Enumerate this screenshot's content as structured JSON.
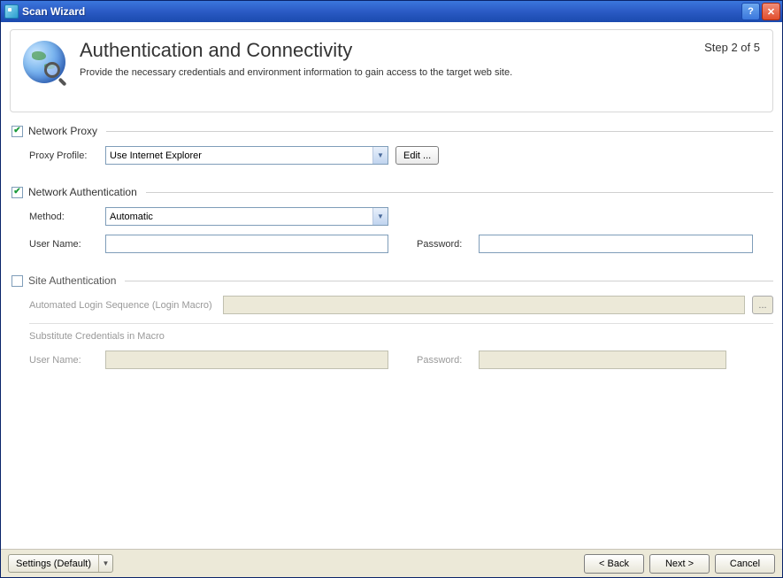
{
  "window": {
    "title": "Scan Wizard"
  },
  "header": {
    "title": "Authentication and Connectivity",
    "subtitle": "Provide the necessary credentials and environment information to gain access to the target web site.",
    "step": "Step 2 of 5"
  },
  "sections": {
    "networkProxy": {
      "title": "Network Proxy",
      "checked": true,
      "proxyProfileLabel": "Proxy Profile:",
      "proxyProfileValue": "Use Internet Explorer",
      "editButton": "Edit ..."
    },
    "networkAuth": {
      "title": "Network Authentication",
      "checked": true,
      "methodLabel": "Method:",
      "methodValue": "Automatic",
      "userNameLabel": "User Name:",
      "userNameValue": "",
      "passwordLabel": "Password:",
      "passwordValue": ""
    },
    "siteAuth": {
      "title": "Site Authentication",
      "checked": false,
      "macroLabel": "Automated Login Sequence (Login Macro)",
      "macroValue": "",
      "browseLabel": "...",
      "subCredsLabel": "Substitute Credentials in Macro",
      "userNameLabel": "User Name:",
      "userNameValue": "",
      "passwordLabel": "Password:",
      "passwordValue": ""
    }
  },
  "footer": {
    "settingsLabel": "Settings (Default)",
    "back": "< Back",
    "next": "Next >",
    "cancel": "Cancel"
  }
}
